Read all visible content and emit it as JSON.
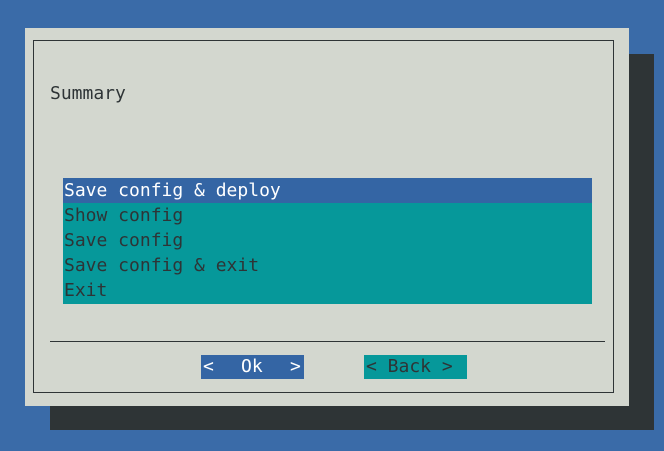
{
  "dialog": {
    "prompt": "Summary"
  },
  "menu": {
    "items": [
      {
        "label": "Save config & deploy",
        "selected": true
      },
      {
        "label": "Show config",
        "selected": false
      },
      {
        "label": "Save config",
        "selected": false
      },
      {
        "label": "Save config & exit",
        "selected": false
      },
      {
        "label": "Exit",
        "selected": false
      }
    ]
  },
  "buttons": {
    "ok": {
      "left": "<",
      "label": "Ok",
      "right": ">"
    },
    "back": {
      "label": "< Back >"
    }
  },
  "colors": {
    "screen_background": "#3a6ba8",
    "dialog_background": "#d3d7cf",
    "menu_background": "#06989a",
    "selection": "#3465a4",
    "text": "#2e3436",
    "shadow": "#2e3436"
  }
}
